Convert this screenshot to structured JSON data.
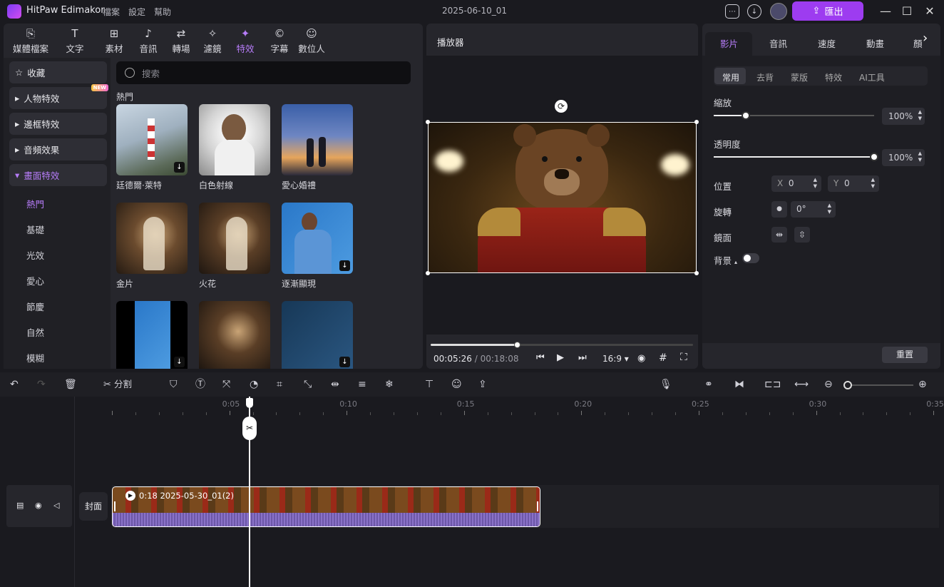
{
  "app": {
    "name": "HitPaw Edimakor",
    "menus": [
      "檔案",
      "設定",
      "幫助"
    ],
    "doc_title": "2025-06-10_01",
    "export_label": "匯出"
  },
  "media_tabs": [
    {
      "label": "媒體檔案",
      "icon": "media-icon"
    },
    {
      "label": "文字",
      "icon": "text-icon"
    },
    {
      "label": "素材",
      "icon": "assets-icon"
    },
    {
      "label": "音訊",
      "icon": "audio-icon"
    },
    {
      "label": "轉場",
      "icon": "transition-icon"
    },
    {
      "label": "濾鏡",
      "icon": "filter-icon"
    },
    {
      "label": "特效",
      "icon": "effects-icon"
    },
    {
      "label": "字幕",
      "icon": "subtitle-icon"
    },
    {
      "label": "數位人",
      "icon": "avatar-icon"
    }
  ],
  "sidebar": {
    "favorites": "收藏",
    "groups": [
      "人物特效",
      "邊框特效",
      "音頻效果",
      "畫面特效"
    ],
    "new_badge": "NEW",
    "subitems": [
      "熱門",
      "基礎",
      "光效",
      "愛心",
      "節慶",
      "自然",
      "模糊"
    ]
  },
  "search": {
    "placeholder": "搜索"
  },
  "effects": {
    "section": "熱門",
    "items": [
      {
        "name": "廷德爾·萊特"
      },
      {
        "name": "白色射線"
      },
      {
        "name": "愛心婚禮"
      },
      {
        "name": "金片"
      },
      {
        "name": "火花"
      },
      {
        "name": "逐漸顯現"
      }
    ]
  },
  "player": {
    "title": "播放器",
    "current_time": "00:05:26",
    "total_time": "00:18:08",
    "aspect": "16:9",
    "progress": 0.33
  },
  "inspector": {
    "tabs": [
      "影片",
      "音訊",
      "速度",
      "動畫",
      "顏"
    ],
    "subtabs": [
      "常用",
      "去背",
      "蒙版",
      "特效",
      "AI工具"
    ],
    "scale_label": "縮放",
    "scale_value": "100%",
    "scale_level": 0.2,
    "opacity_label": "透明度",
    "opacity_value": "100%",
    "opacity_level": 1.0,
    "position_label": "位置",
    "x_label": "X",
    "x_value": "0",
    "y_label": "Y",
    "y_value": "0",
    "rotate_label": "旋轉",
    "rotate_value": "0°",
    "mirror_label": "鏡面",
    "background_label": "背景",
    "reset_label": "重置"
  },
  "toolbar": {
    "split_label": "分割"
  },
  "timeline": {
    "ticks": [
      "0:05",
      "0:10",
      "0:15",
      "0:20",
      "0:25",
      "0:30",
      "0:35"
    ],
    "cover_label": "封面",
    "clip_label": "0:18 2025-05-30_01(2)"
  },
  "colors": {
    "accent": "#9d3cf0",
    "active_text": "#b67cf8",
    "panel": "#26262c"
  }
}
